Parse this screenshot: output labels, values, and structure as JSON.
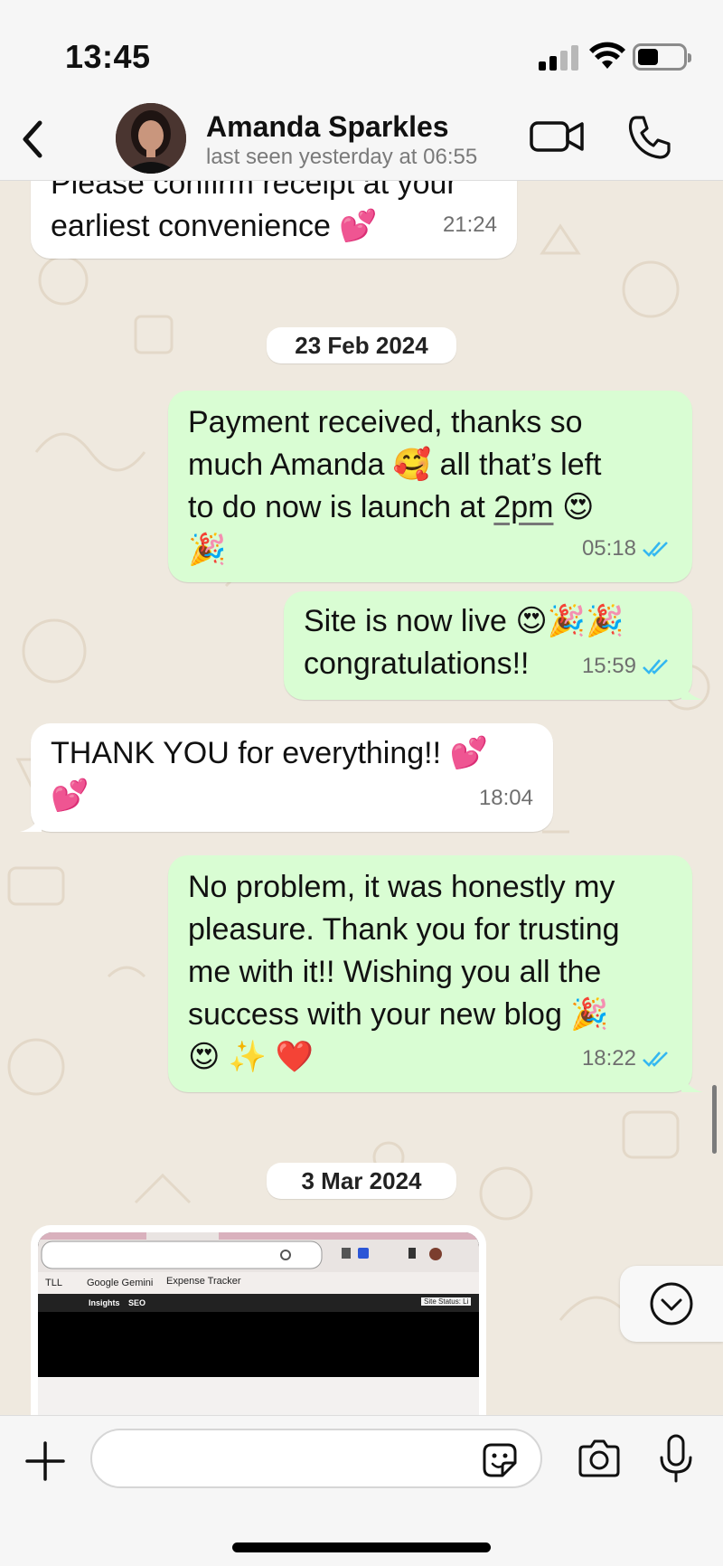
{
  "status_bar": {
    "time": "13:45"
  },
  "header": {
    "contact_name": "Amanda Sparkles",
    "contact_status": "last seen yesterday at 06:55"
  },
  "messages": [
    {
      "direction": "in",
      "lines": [
        "Please confirm receipt at your",
        "earliest convenience 💕"
      ],
      "time": "21:24"
    },
    {
      "type": "date",
      "label": "23 Feb 2024"
    },
    {
      "direction": "out",
      "lines": [
        "Payment received, thanks so",
        "much Amanda 🥰 all that’s left",
        "to do now is launch at",
        "2pm",
        "😍",
        "🎉"
      ],
      "time": "05:18",
      "read": true
    },
    {
      "direction": "out",
      "lines": [
        "Site is now live 😍🎉🎉",
        "congratulations!!"
      ],
      "time": "15:59",
      "read": true
    },
    {
      "direction": "in",
      "lines": [
        "THANK YOU for everything!! 💕",
        "💕"
      ],
      "time": "18:04"
    },
    {
      "direction": "out",
      "lines": [
        "No problem, it was honestly my",
        "pleasure. Thank you for trusting",
        "me with it!! Wishing you all the",
        "success with your new blog 🎉",
        "😍 ✨ ❤️"
      ],
      "time": "18:22",
      "read": true
    },
    {
      "type": "date",
      "label": "3 Mar 2024"
    },
    {
      "direction": "in",
      "type": "image",
      "image_text": {
        "bookmark_1": "TLL",
        "bookmark_2": "Google Gemini",
        "bookmark_3": "Expense Tracker",
        "toolbar_1": "Insights",
        "toolbar_2": "SEO",
        "toolbar_3": "Site Status: Li"
      }
    }
  ],
  "colors": {
    "outgoing": "#d9fdd3",
    "incoming": "#ffffff",
    "tick": "#34b7f1",
    "wallpaper": "#efe9df"
  },
  "input": {
    "placeholder": "",
    "value": ""
  },
  "icons": [
    "back-chevron-icon",
    "video-call-icon",
    "voice-call-icon",
    "plus-icon",
    "sticker-icon",
    "camera-icon",
    "microphone-icon",
    "chevron-down-icon",
    "double-tick-icon"
  ]
}
